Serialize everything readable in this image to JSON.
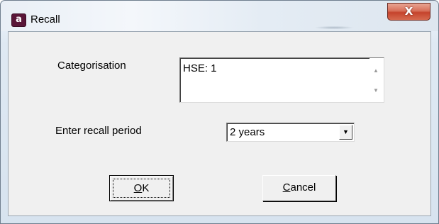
{
  "window": {
    "title": "Recall",
    "app_icon_letter": "a",
    "close_glyph": "X",
    "accent_color": "#5a1638"
  },
  "form": {
    "categorisation_label": "Categorisation",
    "categorisation_value": "HSE:  1",
    "recall_period_label": "Enter recall period",
    "recall_period_value": "2 years"
  },
  "buttons": {
    "ok": {
      "mnemonic": "O",
      "rest": "K"
    },
    "cancel": {
      "mnemonic": "C",
      "rest": "ancel"
    }
  },
  "icons": {
    "scroll_up": "scroll-up-arrow-icon",
    "scroll_down": "scroll-down-arrow-icon",
    "dropdown": "chevron-down-icon",
    "close": "close-icon",
    "app": "app-logo-icon"
  }
}
